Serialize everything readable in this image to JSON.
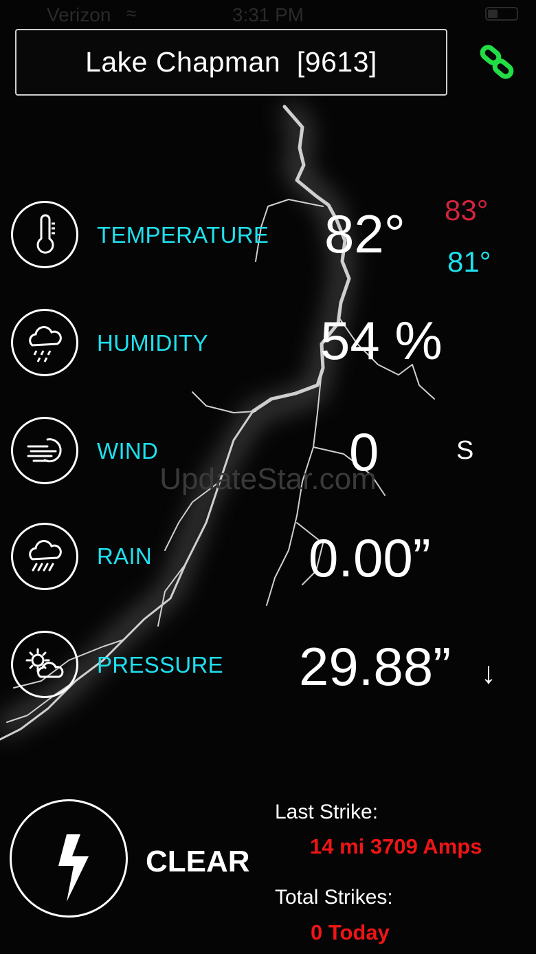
{
  "status_bar": {
    "carrier": "Verizon",
    "time": "3:31 PM"
  },
  "station": {
    "name": "Lake Chapman  [9613]"
  },
  "colors": {
    "accent_cyan": "#1ee0ee",
    "high_red": "#d3243c",
    "strike_red": "#ef1515",
    "link_green": "#22dd44"
  },
  "icons": {
    "link": "link-icon",
    "temperature": "thermometer-icon",
    "humidity": "cloud-drops-icon",
    "wind": "wind-icon",
    "rain": "cloud-rain-icon",
    "pressure": "sun-cloud-icon",
    "lightning": "lightning-bolt-icon"
  },
  "readings": {
    "temperature": {
      "label": "TEMPERATURE",
      "value": "82°",
      "high": "83°",
      "low": "81°"
    },
    "humidity": {
      "label": "HUMIDITY",
      "value": "54 %"
    },
    "wind": {
      "label": "WIND",
      "value": "0",
      "direction": "S"
    },
    "rain": {
      "label": "RAIN",
      "value": "0.00”"
    },
    "pressure": {
      "label": "PRESSURE",
      "value": "29.88”",
      "trend": "↓"
    }
  },
  "watermark": "UpdateStar.com",
  "lightning": {
    "status": "CLEAR",
    "last_strike_label": "Last Strike:",
    "last_strike_value": "14 mi 3709 Amps",
    "total_strikes_label": "Total Strikes:",
    "total_strikes_value": "0 Today"
  }
}
